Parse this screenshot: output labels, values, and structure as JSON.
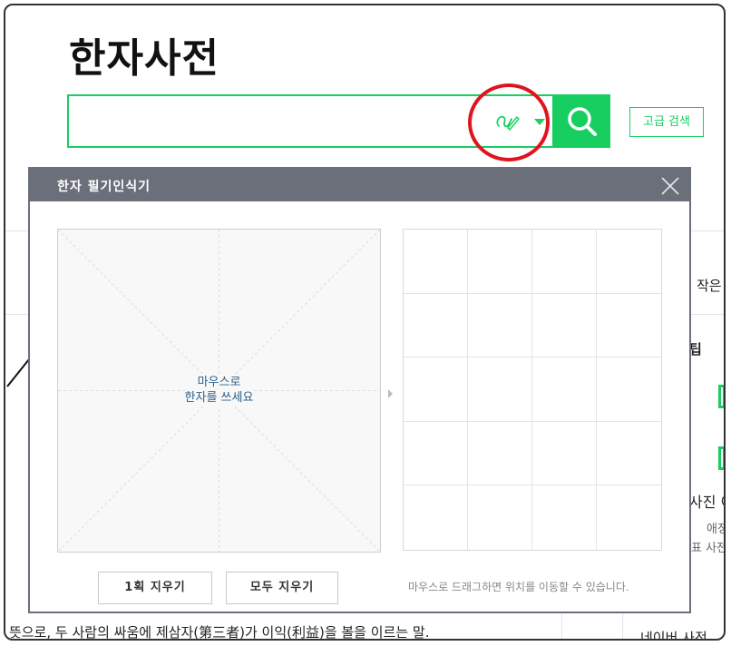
{
  "page": {
    "title": "한자사전"
  },
  "search": {
    "value": "",
    "advanced_label": "고급 검색"
  },
  "background": {
    "right_small_label": "작은",
    "right_tip": "팁",
    "right_dict": "사진 이",
    "right_love": "애정",
    "right_rep": "표 사전",
    "bottom_sentence": "뜻으로, 두 사람의 싸움에 제삼자(第三者)가 이익(利益)을 볼을 이르는 말.",
    "bottom_right": "네이버 사전"
  },
  "handwriting": {
    "title": "한자 필기인식기",
    "draw_hint_line1": "마우스로",
    "draw_hint_line2": "한자를 쓰세요",
    "clear_stroke_label": "1획 지우기",
    "clear_all_label": "모두 지우기",
    "drag_note": "마우스로 드래그하면 위치를 이동할 수 있습니다.",
    "candidate_rows": 5,
    "candidate_cols": 4
  },
  "colors": {
    "accent": "#19ce60",
    "highlight": "#e0141e",
    "panel_header": "#6b6f7a"
  },
  "icons": {
    "handwriting": "pen-icon",
    "dropdown": "caret-down-icon",
    "search": "search-icon",
    "close": "close-icon"
  }
}
